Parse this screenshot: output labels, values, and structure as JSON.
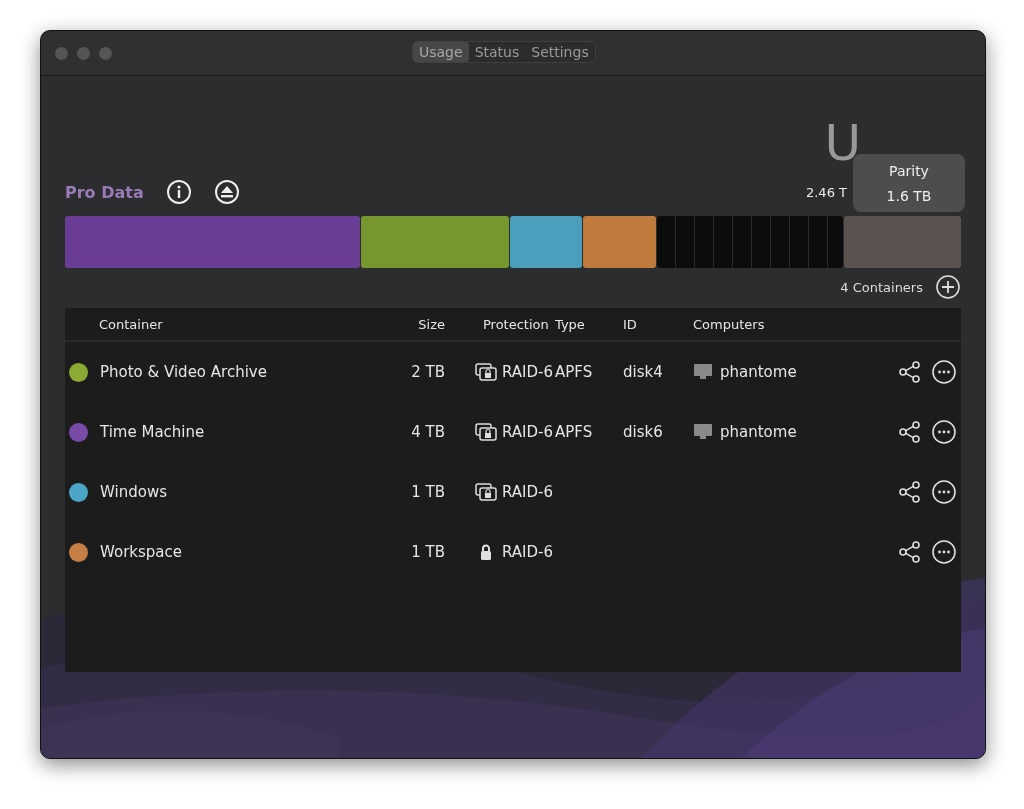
{
  "tabs": [
    {
      "label": "Usage",
      "selected": true
    },
    {
      "label": "Status",
      "selected": false
    },
    {
      "label": "Settings",
      "selected": false
    }
  ],
  "heading": "U",
  "volume": {
    "name": "Pro Data",
    "capacity": "2.46 T"
  },
  "usage_bar": [
    {
      "kind": "used",
      "color": "#6a3d94"
    },
    {
      "kind": "used",
      "color": "#76962e"
    },
    {
      "kind": "used",
      "color": "#4b9fbd"
    },
    {
      "kind": "used",
      "color": "#c07a3c"
    },
    {
      "kind": "free"
    },
    {
      "kind": "parity",
      "color": "#5a5350"
    }
  ],
  "tooltip": {
    "title": "Parity",
    "value": "1.6 TB"
  },
  "container_count": "4 Containers",
  "table": {
    "columns": [
      "Container",
      "Size",
      "Protection",
      "Type",
      "ID",
      "Computers"
    ],
    "rows": [
      {
        "color": "#8aaa34",
        "name": "Photo & Video Archive",
        "size": "2 TB",
        "kind": "shared",
        "protection": "RAID-6",
        "type": "APFS",
        "id": "disk4",
        "computer": "phantome"
      },
      {
        "color": "#7a4aa8",
        "name": "Time Machine",
        "size": "4 TB",
        "kind": "shared",
        "protection": "RAID-6",
        "type": "APFS",
        "id": "disk6",
        "computer": "phantome"
      },
      {
        "color": "#4ba5c6",
        "name": "Windows",
        "size": "1 TB",
        "kind": "shared",
        "protection": "RAID-6"
      },
      {
        "color": "#c57e45",
        "name": "Workspace",
        "size": "1 TB",
        "kind": "lock",
        "protection": "RAID-6"
      }
    ]
  }
}
